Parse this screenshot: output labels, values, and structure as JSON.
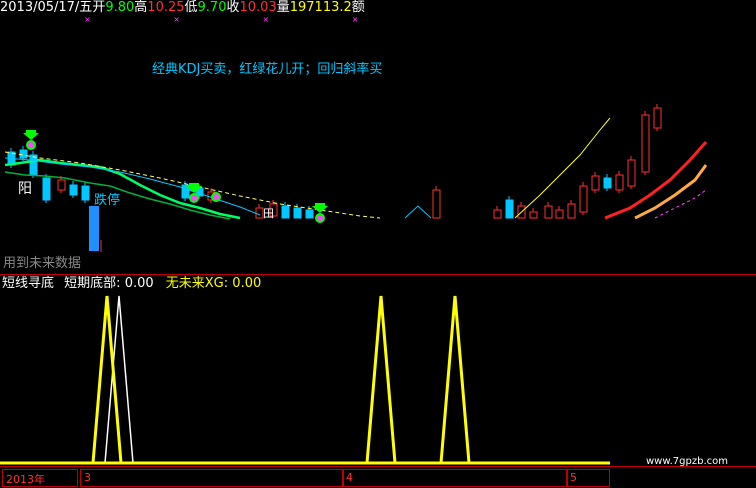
{
  "info": {
    "date": "2013/05/17/五",
    "open_label": "开",
    "open": "9.80",
    "high_label": "高",
    "high": "10.25",
    "low_label": "低",
    "low": "9.70",
    "close_label": "收",
    "close": "10.03",
    "vol_label": "量",
    "vol": "197113.2",
    "amt_label": "额"
  },
  "colors": {
    "open": "#00ff00",
    "high": "#ff3030",
    "low": "#00ff00",
    "close": "#ff3030",
    "label": "#ffffff",
    "cyan": "#00c8ff",
    "yellow": "#ffff00",
    "up": "#ff3030",
    "down": "#00c8ff",
    "ma1": "#00ff66",
    "ma2": "#00c040",
    "ma3": "#ffff66"
  },
  "upper": {
    "title_text": "经典KDJ买卖，红绿花儿开；回归斜率买",
    "label_yang": "阳",
    "label_limit_down": "跌停",
    "label_future": "用到未来数据",
    "label_tian": "田"
  },
  "indicator": {
    "name": "短线寻底",
    "line1_label": "短期底部:",
    "line1_value": "0.00",
    "line2_label": "无未来XG:",
    "line2_value": "0.00"
  },
  "axis": {
    "year": "2013年",
    "months": [
      "3",
      "4",
      "5"
    ]
  },
  "watermark": "www.7gpzb.com",
  "marks": "× × × ×",
  "chart_data": {
    "type": "line",
    "series": [
      {
        "name": "短期底部",
        "spikes_at_candle": [
          10,
          38,
          45
        ]
      },
      {
        "name": "无未来XG",
        "spikes_at_candle": [
          11
        ]
      }
    ]
  }
}
